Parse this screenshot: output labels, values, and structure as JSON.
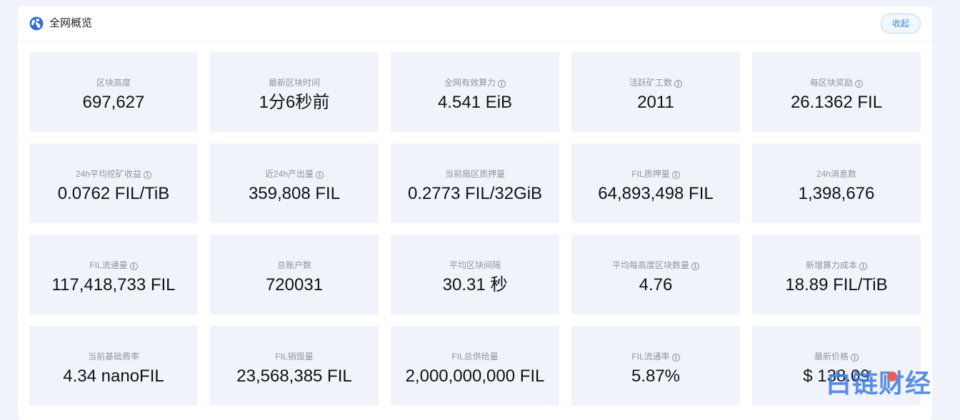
{
  "header": {
    "title": "全网概览",
    "collapse_label": "收起"
  },
  "stats": [
    {
      "label": "区块高度",
      "value": "697,627",
      "info": false
    },
    {
      "label": "最新区块时间",
      "value": "1分6秒前",
      "info": false
    },
    {
      "label": "全网有效算力",
      "value": "4.541 EiB",
      "info": true
    },
    {
      "label": "活跃矿工数",
      "value": "2011",
      "info": true
    },
    {
      "label": "每区块奖励",
      "value": "26.1362 FIL",
      "info": true
    },
    {
      "label": "24h平均挖矿收益",
      "value": "0.0762 FIL/TiB",
      "info": true
    },
    {
      "label": "近24h产出量",
      "value": "359,808 FIL",
      "info": true
    },
    {
      "label": "当前扇区质押量",
      "value": "0.2773 FIL/32GiB",
      "info": false
    },
    {
      "label": "FIL质押量",
      "value": "64,893,498 FIL",
      "info": true
    },
    {
      "label": "24h消息数",
      "value": "1,398,676",
      "info": false
    },
    {
      "label": "FIL流通量",
      "value": "117,418,733 FIL",
      "info": true
    },
    {
      "label": "总账户数",
      "value": "720031",
      "info": false
    },
    {
      "label": "平均区块间隔",
      "value": "30.31 秒",
      "info": false
    },
    {
      "label": "平均每高度区块数量",
      "value": "4.76",
      "info": true
    },
    {
      "label": "新增算力成本",
      "value": "18.89 FIL/TiB",
      "info": true
    },
    {
      "label": "当前基础费率",
      "value": "4.34 nanoFIL",
      "info": false
    },
    {
      "label": "FIL销毁量",
      "value": "23,568,385 FIL",
      "info": false
    },
    {
      "label": "FIL总供给量",
      "value": "2,000,000,000 FIL",
      "info": false
    },
    {
      "label": "FIL流通率",
      "value": "5.87%",
      "info": true
    },
    {
      "label": "最新价格",
      "value": "$ 138.09",
      "info": true
    }
  ],
  "watermark": {
    "text": "白链财经"
  },
  "colors": {
    "accent": "#3a86e0",
    "card_bg": "#f0f4fa",
    "page_bg": "#f0f4fa",
    "label": "#8d959e",
    "value": "#111111"
  }
}
